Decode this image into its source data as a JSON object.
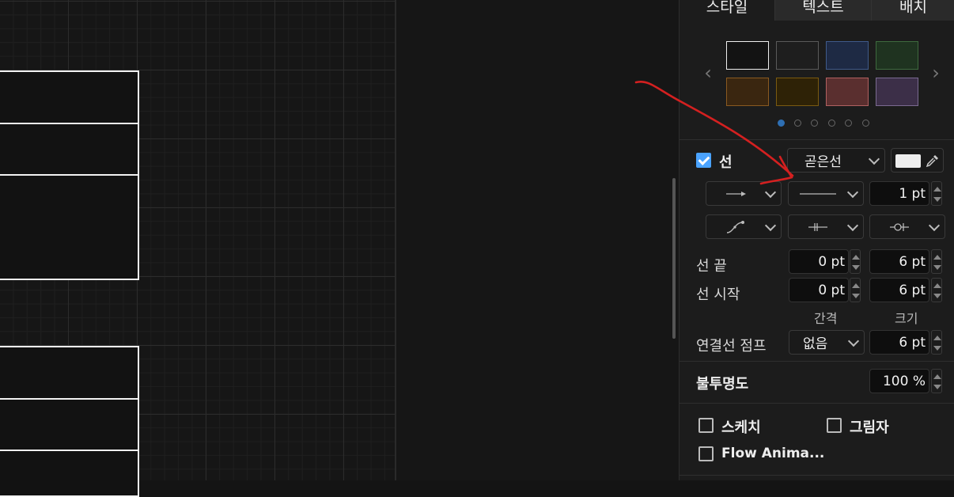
{
  "tabs": {
    "style": "스타일",
    "text": "텍스트",
    "arrange": "배치"
  },
  "swatches": [
    "#131313",
    "#1e1e1e",
    "#1e2a44",
    "#1f3320",
    "#3a2610",
    "#2e2206",
    "#5a2f2f",
    "#3c2f48"
  ],
  "swatch_borders": [
    "#eeeeee",
    "#5a5a5a",
    "#3f5a8a",
    "#3e6a3e",
    "#8a5a20",
    "#7a5a10",
    "#b06060",
    "#7a6a90"
  ],
  "palette_page": {
    "total": 6,
    "active": 0
  },
  "line": {
    "checkbox_label": "선",
    "checked": true,
    "style_value": "곧은선",
    "color": "#eeeeee",
    "width": "1 pt"
  },
  "line_end": {
    "label": "선 끝",
    "spacing": "0 pt",
    "size": "6 pt"
  },
  "line_start": {
    "label": "선 시작",
    "spacing": "0 pt",
    "size": "6 pt"
  },
  "col_headers": {
    "spacing": "간격",
    "size": "크기"
  },
  "connector_jump": {
    "label": "연결선 점프",
    "value": "없음",
    "size": "6 pt"
  },
  "opacity": {
    "label": "불투명도",
    "value": "100 %"
  },
  "options": {
    "sketch": "스케치",
    "shadow": "그림자",
    "flow": "Flow Anima..."
  }
}
